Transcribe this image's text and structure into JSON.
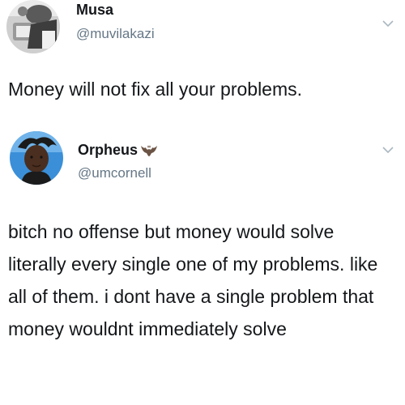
{
  "tweets": [
    {
      "display_name": "Musa",
      "handle": "@muvilakazi",
      "text": "Money will not fix all your problems.",
      "avatar_icon": "user-avatar-photo",
      "menu_icon": "chevron-down-icon"
    },
    {
      "display_name": "Orpheus",
      "name_badge_icon": "bat-emoji-icon",
      "handle": "@umcornell",
      "text": "bitch no offense but money would solve literally every single one of my problems. like all of them. i dont have a single problem that money wouldnt immediately solve",
      "avatar_icon": "user-avatar-photo",
      "menu_icon": "chevron-down-icon"
    }
  ],
  "colors": {
    "name": "#14171a",
    "handle": "#657786",
    "chevron": "#aab8c2",
    "background": "#ffffff"
  }
}
